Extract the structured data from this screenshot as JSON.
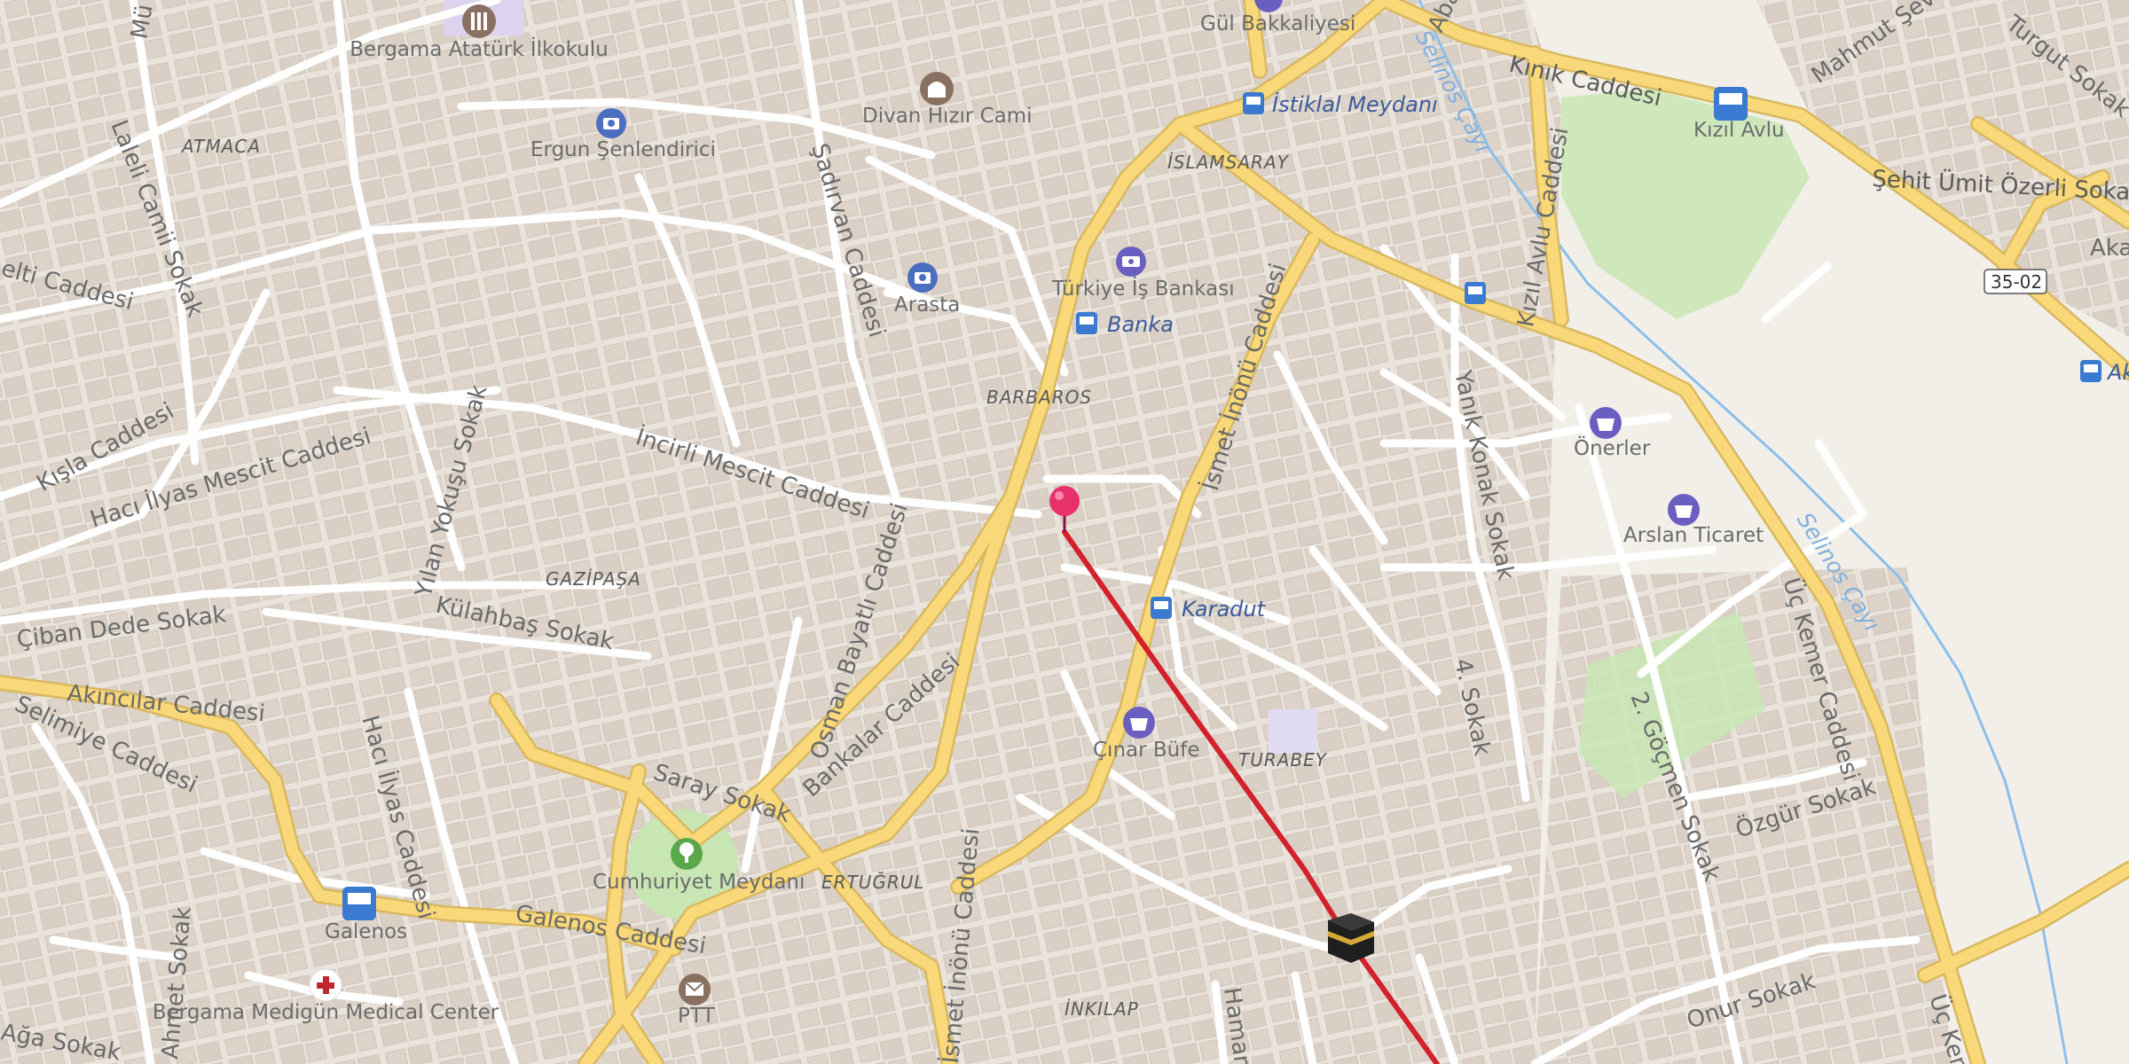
{
  "map": {
    "streets": {
      "kinik": "Kınık Caddesi",
      "sehit_umit": "Şehit Ümit Özerli Sokak",
      "mahmut": "Mahmut Şevke",
      "turgut": "Turgut Sokak",
      "akas": "Akas",
      "aba": "Aba",
      "sadirvan": "Şadırvan Caddesi",
      "laleli": "Laleli Camii Sokak",
      "musalla": "Mü",
      "kisla": "Kışla Caddesi",
      "haci_ilyas_mescit": "Hacı İlyas Mescit Caddesi",
      "incirli": "İncirli Mescit Caddesi",
      "kilicarslan": "elti Caddesi",
      "yilan": "Yılan Yokuşu Sokak",
      "kulahbas": "Külahbaş Sokak",
      "ciban": "Çiban Dede Sokak",
      "akincilar": "Akıncılar Caddesi",
      "selimiye": "Selimiye Caddesi",
      "haci_ilyas": "Hacı İlyas Caddesi",
      "osman": "Osman Bayatlı Caddesi",
      "saray": "Saray Sokak",
      "bankalar": "Bankalar Caddesi",
      "galenos": "Galenos Caddesi",
      "ismet_1": "İsmet İnönü Caddesi",
      "ismet_2": "İsmet İnönü Caddesi",
      "kizil_avlu": "Kızıl Avlu Caddesi",
      "yanik_konak": "Yanık Konak Sokak",
      "dort": "4. Sokak",
      "iki_gocmen": "2. Göçmen Sokak",
      "uc_kemer": "Üç Kemer Caddesi",
      "uc_kemer_2": "Üç Kem",
      "ozgur": "Özgür Sokak",
      "onur": "Onur Sokak",
      "hamam": "Hamam",
      "aga": "Ağa Sokak",
      "ahmet": "Ahmet Sokak"
    },
    "districts": {
      "atmaca": "ATMACA",
      "islamsaray": "İSLAMSARAY",
      "barbaros": "BARBAROS",
      "gazipasa": "GAZİPAŞA",
      "turabey": "TURABEY",
      "ertugrul": "ERTUĞRUL",
      "inkilap": "İNKILAP"
    },
    "water": {
      "selinos_1": "Selinos Çayı",
      "selinos_2": "Selinos Çayı"
    },
    "road_ref": "35-02",
    "pois": {
      "bergama_school": "Bergama Atatürk İlkokulu",
      "gul": "Gül Bakkaliyesi",
      "divan": "Divan Hızır Cami",
      "ergun": "Ergun Şenlendirici",
      "turkiye_is": "Türkiye İş Bankası",
      "arasta": "Arasta",
      "onerler": "Önerler",
      "arslan": "Arslan Ticaret",
      "cinar": "Çınar Büfe",
      "cumhuriyet": "Cumhuriyet Meydanı",
      "ptt": "PTT",
      "hospital": "Bergama Medigün Medical Center"
    },
    "bus_stops": {
      "istiklal": "İstiklal Meydanı",
      "kizil_avlu": "Kızıl Avlu",
      "banka": "Banka",
      "karadut": "Karadut",
      "galenos": "Galenos",
      "ak": "Ak"
    },
    "icons": [
      "marker-pin-icon",
      "kaaba-icon",
      "bus-stop-icon",
      "camera-icon",
      "mosque-icon",
      "bank-icon",
      "shop-icon",
      "tree-icon",
      "post-office-icon",
      "hospital-icon",
      "school-icon"
    ],
    "colors": {
      "background": "#f2efe9",
      "building": "#ddd4cb",
      "primary_road": "#f8d878",
      "road": "#ffffff",
      "park": "#c8e6b4",
      "water": "#8cc0ea",
      "route_line": "#d3202a",
      "marker": "#e8306a"
    }
  }
}
